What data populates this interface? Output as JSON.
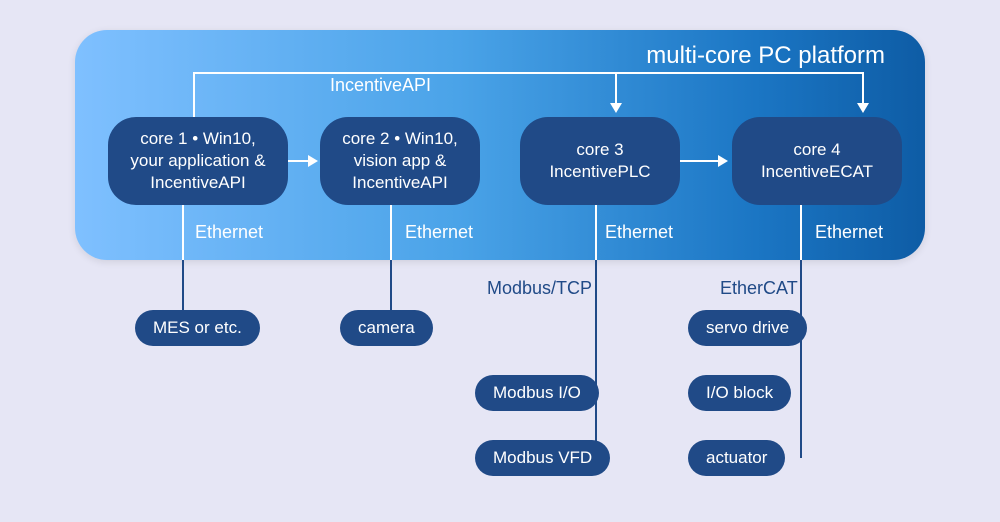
{
  "platform_title": "multi-core PC platform",
  "api_label": "IncentiveAPI",
  "cores": [
    {
      "l1": "core 1 • Win10,",
      "l2": "your application &",
      "l3": "IncentiveAPI"
    },
    {
      "l1": "core 2 • Win10,",
      "l2": "vision app &",
      "l3": "IncentiveAPI"
    },
    {
      "l1": "core 3",
      "l2": "IncentivePLC",
      "l3": ""
    },
    {
      "l1": "core 4",
      "l2": "IncentiveECAT",
      "l3": ""
    }
  ],
  "ethernet_label": "Ethernet",
  "bus": {
    "modbus": "Modbus/TCP",
    "ethercat": "EtherCAT"
  },
  "peripherals": {
    "core1": [
      "MES or etc."
    ],
    "core2": [
      "camera"
    ],
    "core3": [
      "Modbus I/O",
      "Modbus VFD"
    ],
    "core4": [
      "servo drive",
      "I/O block",
      "actuator"
    ]
  }
}
